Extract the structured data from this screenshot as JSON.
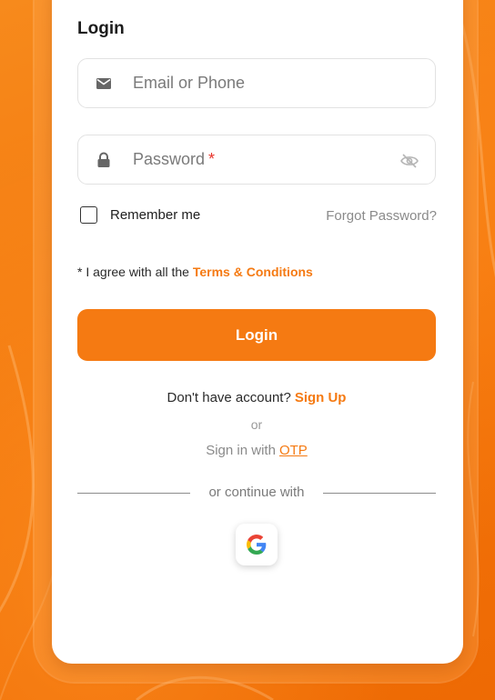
{
  "form": {
    "title": "Login",
    "email_placeholder": "Email or Phone",
    "password_placeholder": "Password",
    "password_required_mark": "*",
    "remember_label": "Remember me",
    "forgot_label": "Forgot Password?",
    "terms_prefix": "* I agree with all the",
    "terms_link": "Terms & Conditions",
    "login_button": "Login",
    "signup_prompt": "Don't have account?",
    "signup_link": "Sign Up",
    "or_text": "or",
    "otp_prompt": "Sign in with",
    "otp_link": "OTP",
    "divider_text": "or continue with"
  },
  "colors": {
    "brand": "#f57a12",
    "background": "#f27208",
    "required": "#e8342b"
  },
  "icons": {
    "email": "envelope-icon",
    "password": "lock-icon",
    "toggle_visibility": "eye-off-icon",
    "social": "google-icon"
  }
}
